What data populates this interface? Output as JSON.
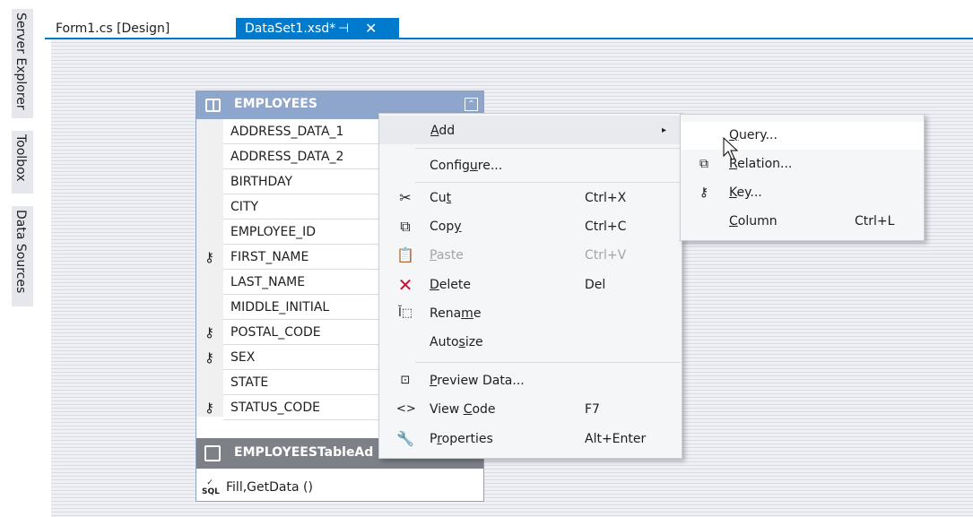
{
  "side_rail": {
    "tabs": [
      "Server Explorer",
      "Toolbox",
      "Data Sources"
    ]
  },
  "doc_tabs": {
    "inactive": "Form1.cs [Design]",
    "active": "DataSet1.xsd*",
    "pin_glyph": "⊣",
    "close_glyph": "✕"
  },
  "table": {
    "name": "EMPLOYEES",
    "columns": [
      {
        "name": "ADDRESS_DATA_1",
        "key": false
      },
      {
        "name": "ADDRESS_DATA_2",
        "key": false
      },
      {
        "name": "BIRTHDAY",
        "key": false
      },
      {
        "name": "CITY",
        "key": false
      },
      {
        "name": "EMPLOYEE_ID",
        "key": false
      },
      {
        "name": "FIRST_NAME",
        "key": true
      },
      {
        "name": "LAST_NAME",
        "key": false
      },
      {
        "name": "MIDDLE_INITIAL",
        "key": false
      },
      {
        "name": "POSTAL_CODE",
        "key": true
      },
      {
        "name": "SEX",
        "key": true
      },
      {
        "name": "STATE",
        "key": false
      },
      {
        "name": "STATUS_CODE",
        "key": true
      }
    ],
    "adapter_name": "EMPLOYEESTableAd",
    "adapter_method": "Fill,GetData ()",
    "sql_label": "SQL"
  },
  "context_menu": {
    "add": {
      "pre": "",
      "u": "A",
      "post": "dd"
    },
    "configure": {
      "pre": "Config",
      "u": "u",
      "post": "re..."
    },
    "cut": {
      "pre": "Cu",
      "u": "t",
      "post": "",
      "shortcut": "Ctrl+X"
    },
    "copy": {
      "pre": "Cop",
      "u": "y",
      "post": "",
      "shortcut": "Ctrl+C"
    },
    "paste": {
      "pre": "",
      "u": "P",
      "post": "aste",
      "shortcut": "Ctrl+V"
    },
    "delete": {
      "pre": "",
      "u": "D",
      "post": "elete",
      "shortcut": "Del"
    },
    "rename": {
      "pre": "Rena",
      "u": "m",
      "post": "e"
    },
    "autosize": {
      "pre": "Auto",
      "u": "s",
      "post": "ize"
    },
    "preview": {
      "pre": "",
      "u": "P",
      "post": "review Data..."
    },
    "view_code": {
      "pre": "View ",
      "u": "C",
      "post": "ode",
      "shortcut": "F7"
    },
    "properties": {
      "pre": "P",
      "u": "r",
      "post": "operties",
      "shortcut": "Alt+Enter"
    }
  },
  "submenu": {
    "query": {
      "pre": "",
      "u": "Q",
      "post": "uery..."
    },
    "relation": {
      "pre": "",
      "u": "R",
      "post": "elation..."
    },
    "key": {
      "pre": "",
      "u": "K",
      "post": "ey..."
    },
    "column": {
      "pre": "",
      "u": "C",
      "post": "olumn",
      "shortcut": "Ctrl+L"
    }
  },
  "icons": {
    "arrow": "▸",
    "key": "⚷",
    "collapse": "⌃"
  }
}
